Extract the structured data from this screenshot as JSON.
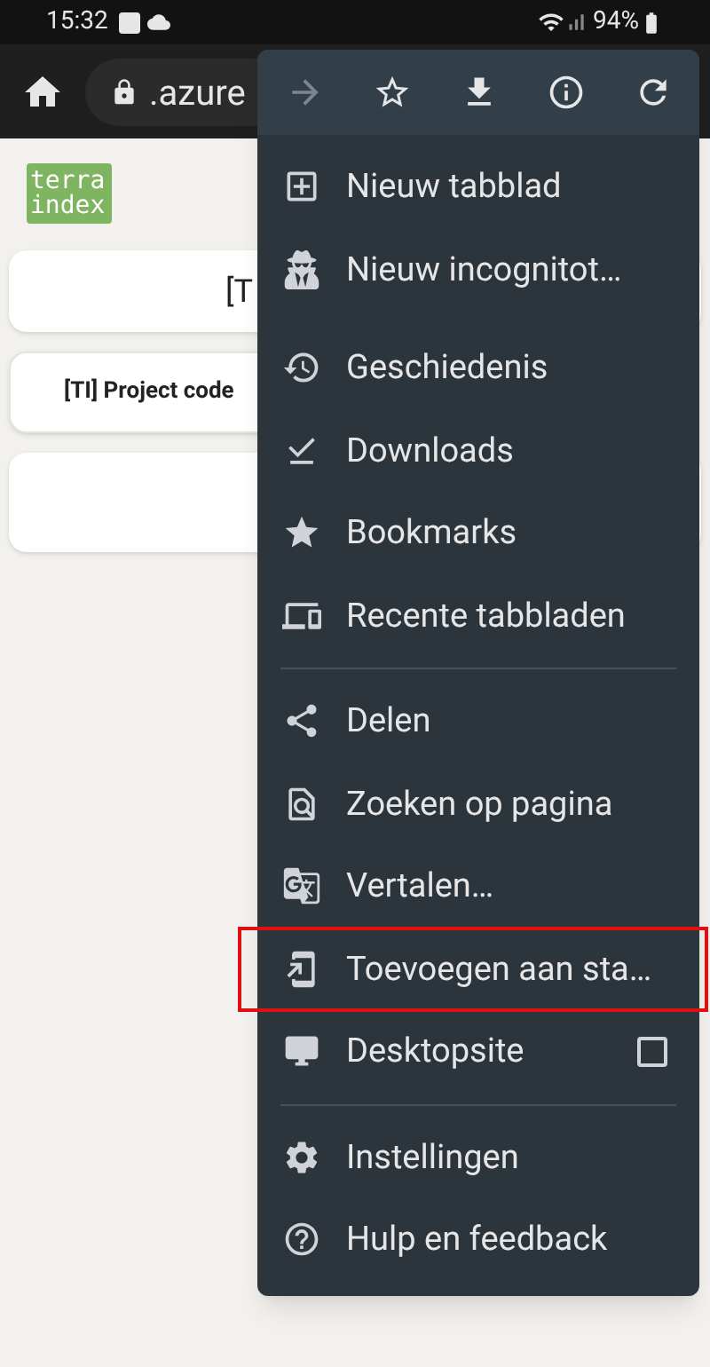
{
  "status_bar": {
    "time": "15:32",
    "battery": "94%"
  },
  "address_bar": {
    "url": ".azure"
  },
  "page": {
    "logo": [
      "terra",
      "index"
    ],
    "cards": [
      {
        "kind": "heading",
        "text": "[T"
      },
      {
        "kind": "tile",
        "text": "[TI] Project code"
      },
      {
        "kind": "blank"
      }
    ]
  },
  "menu": {
    "toolbar": [
      {
        "kind": "forward",
        "disabled": true
      },
      {
        "kind": "bookmark",
        "disabled": false
      },
      {
        "kind": "download",
        "disabled": false
      },
      {
        "kind": "info",
        "disabled": false
      },
      {
        "kind": "reload",
        "disabled": false
      }
    ],
    "sections": [
      {
        "divider": false,
        "items": [
          {
            "label": "Nieuw tabblad",
            "highlighted": false
          },
          {
            "label": "Nieuw incognitot…",
            "highlighted": false
          }
        ]
      },
      {
        "divider": false,
        "items": [
          {
            "label": "Geschiedenis",
            "highlighted": false
          },
          {
            "label": "Downloads",
            "highlighted": false
          },
          {
            "label": "Bookmarks",
            "highlighted": false
          },
          {
            "label": "Recente tabbladen",
            "highlighted": false
          }
        ]
      },
      {
        "divider": true,
        "items": [
          {
            "label": "Delen",
            "highlighted": false
          },
          {
            "label": "Zoeken op pagina",
            "highlighted": false
          },
          {
            "label": "Vertalen…",
            "highlighted": false
          },
          {
            "label": "Toevoegen aan sta…",
            "highlighted": true
          },
          {
            "label": "Desktopsite",
            "highlighted": false,
            "kind": "checkbox",
            "checked": false
          }
        ]
      },
      {
        "divider": true,
        "items": [
          {
            "label": "Instellingen",
            "highlighted": false
          },
          {
            "label": "Hulp en feedback",
            "highlighted": false
          }
        ]
      }
    ]
  }
}
